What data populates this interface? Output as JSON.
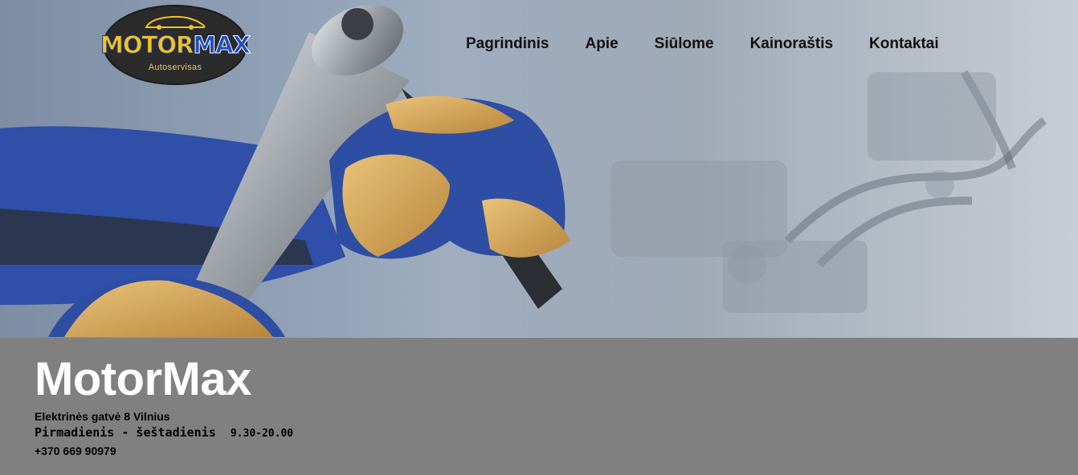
{
  "logo": {
    "primary": "MOTOR",
    "secondary": "MAX",
    "tagline": "Autoservisas",
    "icon": "car-silhouette-icon"
  },
  "nav": {
    "items": [
      "Pagrindinis",
      "Apie",
      "Siūlome",
      "Kainoraštis",
      "Kontaktai"
    ]
  },
  "hero": {
    "image": "mechanic-hands-with-ratchet-over-engine"
  },
  "business": {
    "name": "MotorMax",
    "address": "Elektrinės gatvė 8 Vilnius",
    "days": "Pirmadienis - šeštadienis",
    "hours": "9.30-20.00",
    "phone": "+370 669 90979"
  },
  "colors": {
    "info_background": "#808080",
    "title_color": "#ffffff",
    "logo_yellow": "#f5c518",
    "logo_blue": "#1d4fc4"
  }
}
